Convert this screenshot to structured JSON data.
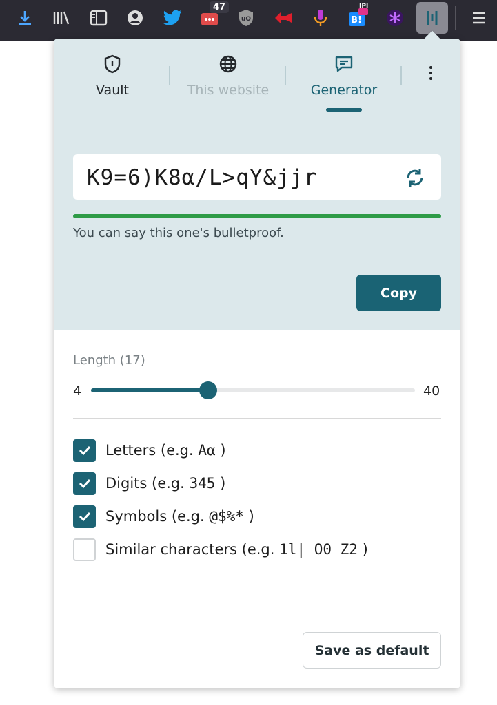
{
  "browser": {
    "toolbar_icons": [
      "download-icon",
      "library-icon",
      "sidebar-icon",
      "account-icon",
      "twitter-icon",
      "extension-icon",
      "ublock-icon",
      "redirect-icon",
      "microphone-icon",
      "hatena-bookmark-icon",
      "beta-extension-icon",
      "password-manager-icon",
      "menu-icon"
    ],
    "badge_count": "47",
    "badge_small": "IPI"
  },
  "tabs": [
    {
      "label": "Vault",
      "icon": "shield-icon",
      "state": "normal"
    },
    {
      "label": "This website",
      "icon": "globe-icon",
      "state": "disabled"
    },
    {
      "label": "Generator",
      "icon": "chat-icon",
      "state": "active"
    }
  ],
  "generator": {
    "password": "K9=6)K8α/L>qY&jjr",
    "strength_text": "You can say this one's bulletproof.",
    "copy_label": "Copy"
  },
  "length": {
    "label": "Length (17)",
    "min": "4",
    "max": "40",
    "value": 17
  },
  "options": [
    {
      "label": "Letters (e.g. ",
      "example": "Aα",
      "suffix": " )",
      "checked": true
    },
    {
      "label": "Digits (e.g. ",
      "example": "345",
      "suffix": " )",
      "checked": true
    },
    {
      "label": "Symbols (e.g. ",
      "example": "@$%*",
      "suffix": " )",
      "checked": true
    },
    {
      "label": "Similar characters (e.g. ",
      "example": "1l| O0 Z2",
      "suffix": " )",
      "checked": false
    }
  ],
  "save_label": "Save as default",
  "colors": {
    "accent": "#1c6374",
    "panel_bg": "#dce8eb",
    "strength_green": "#2e9b47"
  }
}
